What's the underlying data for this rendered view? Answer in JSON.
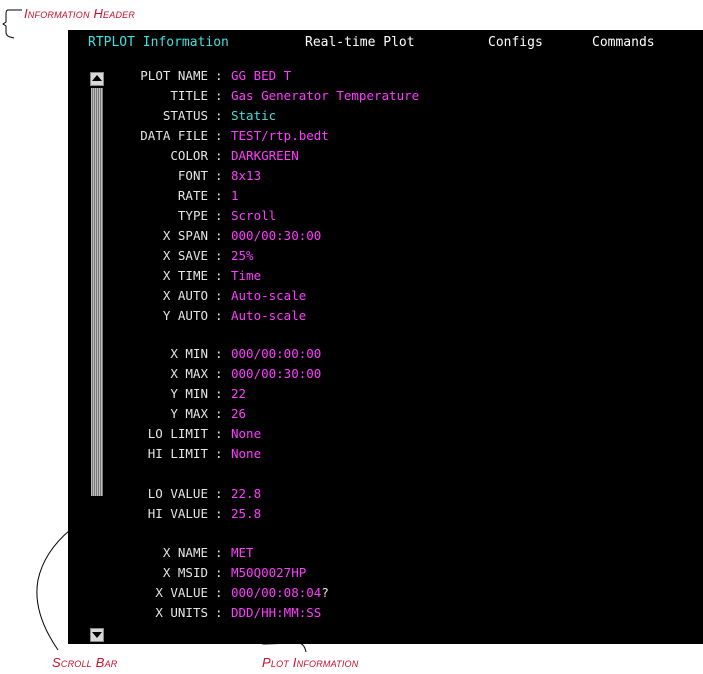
{
  "callouts": {
    "header": "Information Header",
    "scroll": "Scroll Bar",
    "plotinfo": "Plot Information"
  },
  "menubar": {
    "info": "RTPLOT Information",
    "plot": "Real-time Plot",
    "configs": "Configs",
    "commands": "Commands"
  },
  "rows": [
    {
      "label": "PLOT NAME",
      "value": "GG BED T"
    },
    {
      "label": "TITLE",
      "value": "Gas Generator Temperature"
    },
    {
      "label": "STATUS",
      "value": "Static"
    },
    {
      "label": "DATA FILE",
      "value": "TEST/rtp.bedt"
    },
    {
      "label": "COLOR",
      "value": "DARKGREEN"
    },
    {
      "label": "FONT",
      "value": "8x13"
    },
    {
      "label": "RATE",
      "value": "1"
    },
    {
      "label": "TYPE",
      "value": "Scroll"
    },
    {
      "label": "X SPAN",
      "value": "000/00:30:00"
    },
    {
      "label": "X SAVE",
      "value": "25%"
    },
    {
      "label": "X TIME",
      "value": "Time"
    },
    {
      "label": "X AUTO",
      "value": "Auto-scale"
    },
    {
      "label": "Y AUTO",
      "value": "Auto-scale"
    },
    {
      "label": "X MIN",
      "value": "000/00:00:00"
    },
    {
      "label": "X MAX",
      "value": "000/00:30:00"
    },
    {
      "label": "Y MIN",
      "value": "22"
    },
    {
      "label": "Y MAX",
      "value": "26"
    },
    {
      "label": "LO LIMIT",
      "value": "None"
    },
    {
      "label": "HI LIMIT",
      "value": "None"
    },
    {
      "label": "LO VALUE",
      "value": "22.8"
    },
    {
      "label": "HI VALUE",
      "value": "25.8"
    },
    {
      "label": "X NAME",
      "value": "MET"
    },
    {
      "label": "X MSID",
      "value": "M50Q0027HP"
    },
    {
      "label": "X VALUE",
      "value": "000/00:08:04",
      "suffix": "?"
    },
    {
      "label": "X UNITS",
      "value": "DDD/HH:MM:SS"
    }
  ],
  "colors": {
    "label": "#e6e6e6",
    "value": "#ff3cff",
    "status": "#40e0e0",
    "callout": "#c8102e"
  }
}
